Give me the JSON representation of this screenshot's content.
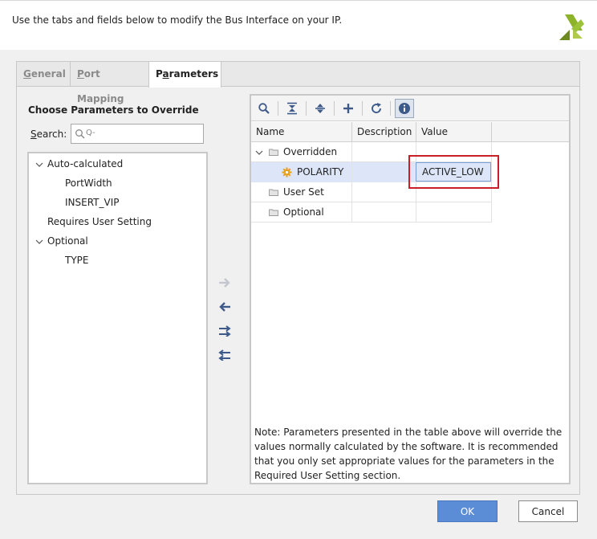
{
  "header": {
    "instruction": "Use the tabs and fields below to modify the Bus Interface on your IP."
  },
  "tabs": [
    {
      "label": "General",
      "underline": "G",
      "rest": "eneral"
    },
    {
      "label": "Port Mapping",
      "underline": "P",
      "rest": "ort Mapping"
    },
    {
      "label": "Parameters",
      "pre": "P",
      "underline": "a",
      "rest": "rameters"
    }
  ],
  "left": {
    "title": "Choose Parameters to Override",
    "search_label": "Search:",
    "search_placeholder": "Q-",
    "tree": {
      "auto_calculated": "Auto-calculated",
      "auto_children": [
        "PortWidth",
        "INSERT_VIP"
      ],
      "requires_user": "Requires User Setting",
      "optional": "Optional",
      "optional_children": [
        "TYPE"
      ]
    }
  },
  "grid": {
    "columns": [
      "Name",
      "Description",
      "Value"
    ],
    "rows": [
      {
        "name": "Overridden",
        "description": "",
        "value": ""
      },
      {
        "name": "POLARITY",
        "description": "",
        "value": "ACTIVE_LOW"
      },
      {
        "name": "User Set",
        "description": "",
        "value": ""
      },
      {
        "name": "Optional",
        "description": "",
        "value": ""
      }
    ]
  },
  "note": "Note: Parameters presented in the table above will override the values normally calculated by the software. It is recommended that you only set appropriate values for the parameters in the Required User Setting section.",
  "buttons": {
    "ok": "OK",
    "cancel": "Cancel"
  },
  "colors": {
    "accent": "#5b8dd6",
    "highlight": "#c8202a",
    "selection": "#dce6f8",
    "icon_blue": "#3d5a8a",
    "gear": "#e8a020"
  }
}
